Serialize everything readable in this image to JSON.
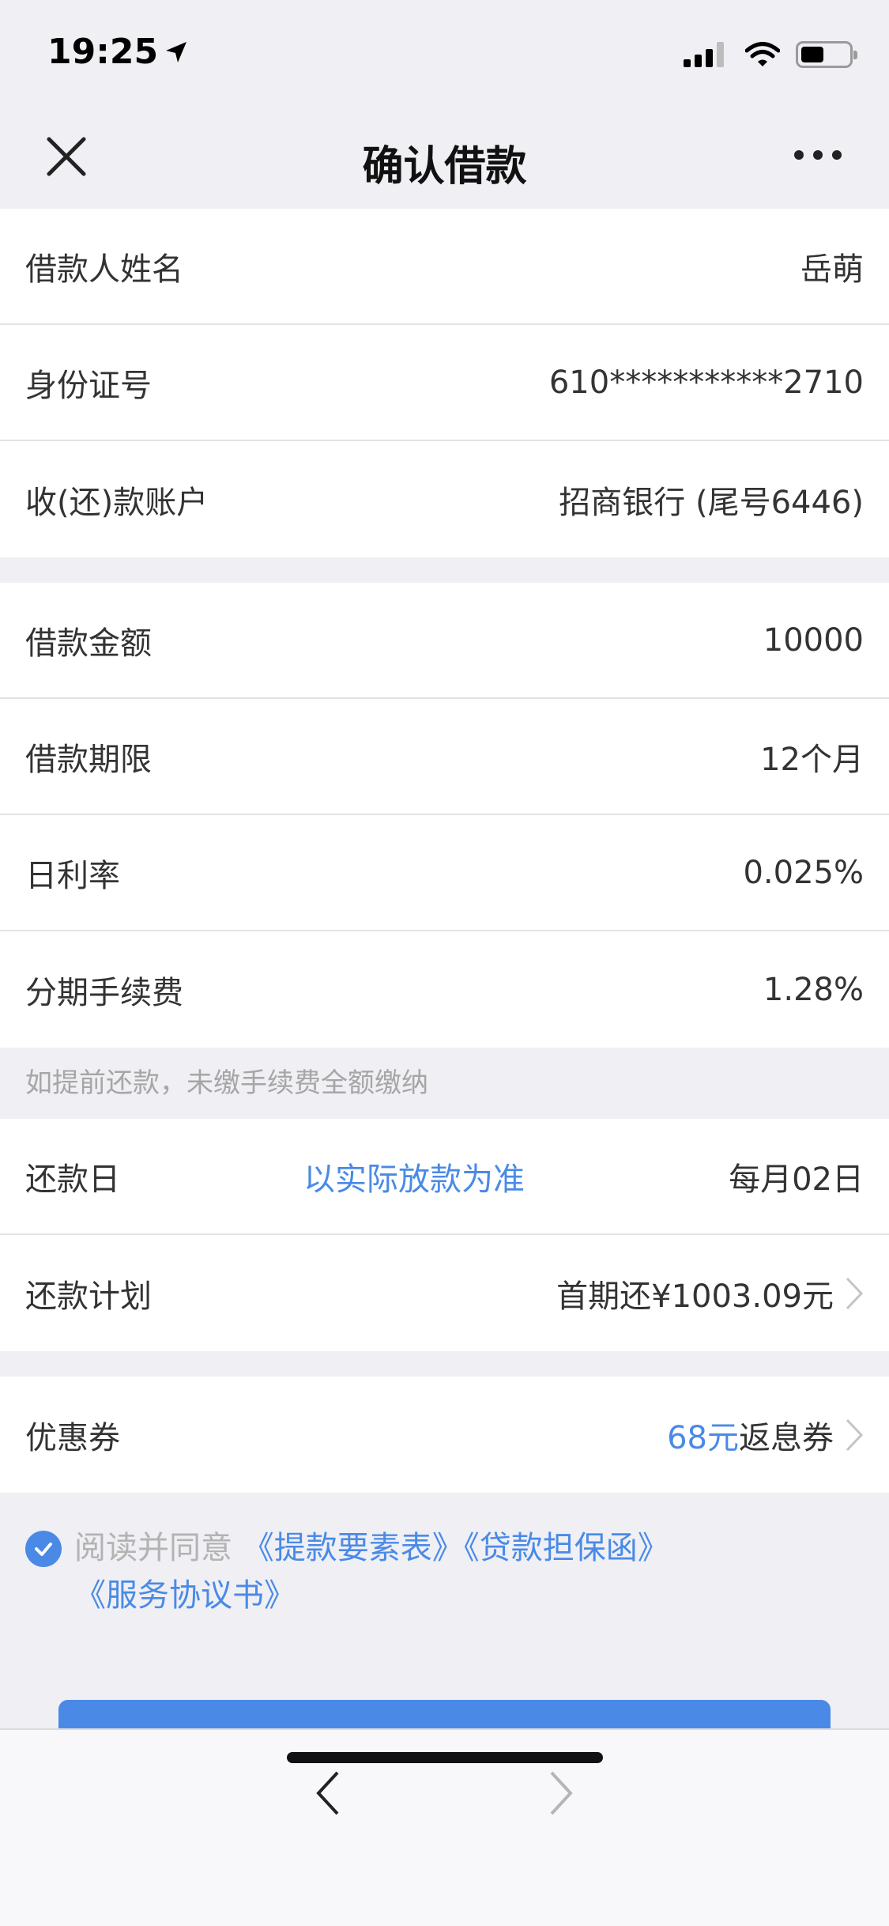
{
  "status_bar": {
    "time": "19:25"
  },
  "nav": {
    "title": "确认借款"
  },
  "borrower": {
    "name_label": "借款人姓名",
    "name_value": "岳萌",
    "id_label": "身份证号",
    "id_value": "610***********2710",
    "account_label": "收(还)款账户",
    "account_value": "招商银行 (尾号6446)"
  },
  "loan": {
    "amount_label": "借款金额",
    "amount_value": "10000",
    "term_label": "借款期限",
    "term_value": "12个月",
    "rate_label": "日利率",
    "rate_value": "0.025%",
    "fee_label": "分期手续费",
    "fee_value": "1.28%"
  },
  "note": "如提前还款，未缴手续费全额缴纳",
  "repay": {
    "day_label": "还款日",
    "day_mid": "以实际放款为准",
    "day_value": "每月02日",
    "plan_label": "还款计划",
    "plan_value": "首期还¥1003.09元"
  },
  "coupon": {
    "label": "优惠券",
    "amount": "68元",
    "suffix": "返息券"
  },
  "agreement": {
    "prefix": "阅读并同意",
    "link1": "《提款要素表》",
    "link2": "《贷款担保函》",
    "link3": "《服务协议书》"
  }
}
